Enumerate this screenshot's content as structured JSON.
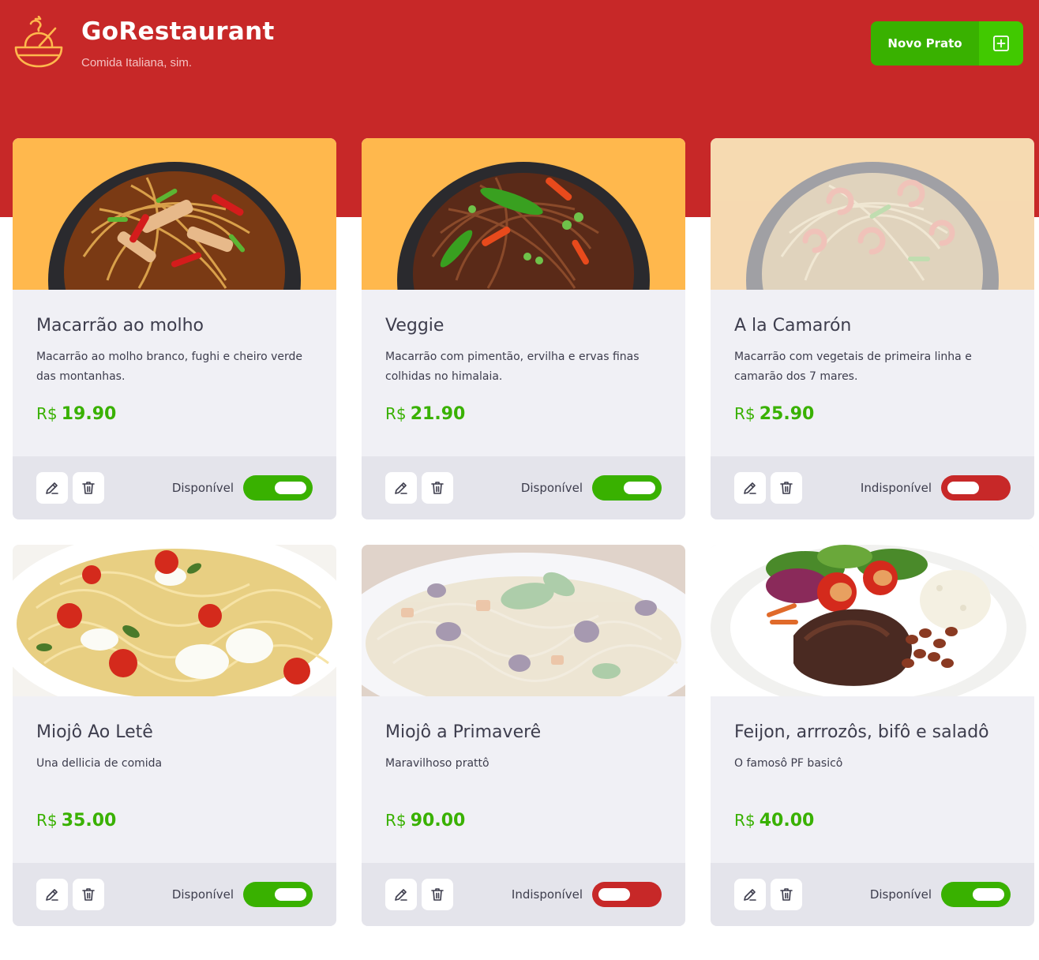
{
  "header": {
    "title": "GoRestaurant",
    "subtitle": "Comida Italiana, sim.",
    "new_button_label": "Novo Prato",
    "new_button_icon": "plus-square-icon",
    "logo_icon": "bowl-logo-icon"
  },
  "colors": {
    "brand_red": "#c72828",
    "green": "#39b100",
    "green_light": "#41c900",
    "card_bg": "#f0f0f5",
    "footer_bg": "#e4e4eb"
  },
  "dishes": [
    {
      "name": "Macarrão ao molho",
      "description": "Macarrão ao molho branco, fughi e cheiro verde das montanhas.",
      "currency": "R$",
      "price": "19.90",
      "status_label": "Disponível",
      "available": true
    },
    {
      "name": "Veggie",
      "description": "Macarrão com pimentão, ervilha e ervas finas colhidas no himalaia.",
      "currency": "R$",
      "price": "21.90",
      "status_label": "Disponível",
      "available": true
    },
    {
      "name": "A la Camarón",
      "description": "Macarrão com vegetais de primeira linha e camarão dos 7 mares.",
      "currency": "R$",
      "price": "25.90",
      "status_label": "Indisponível",
      "available": false
    },
    {
      "name": "Miojô Ao Letê",
      "description": "Una dellicia de comida",
      "currency": "R$",
      "price": "35.00",
      "status_label": "Disponível",
      "available": true
    },
    {
      "name": "Miojô a Primaverê",
      "description": "Maravilhoso prattô",
      "currency": "R$",
      "price": "90.00",
      "status_label": "Indisponível",
      "available": false
    },
    {
      "name": "Feijon, arrrozôs, bifô e saladô",
      "description": "O famosô PF basicô",
      "currency": "R$",
      "price": "40.00",
      "status_label": "Disponível",
      "available": true
    }
  ]
}
